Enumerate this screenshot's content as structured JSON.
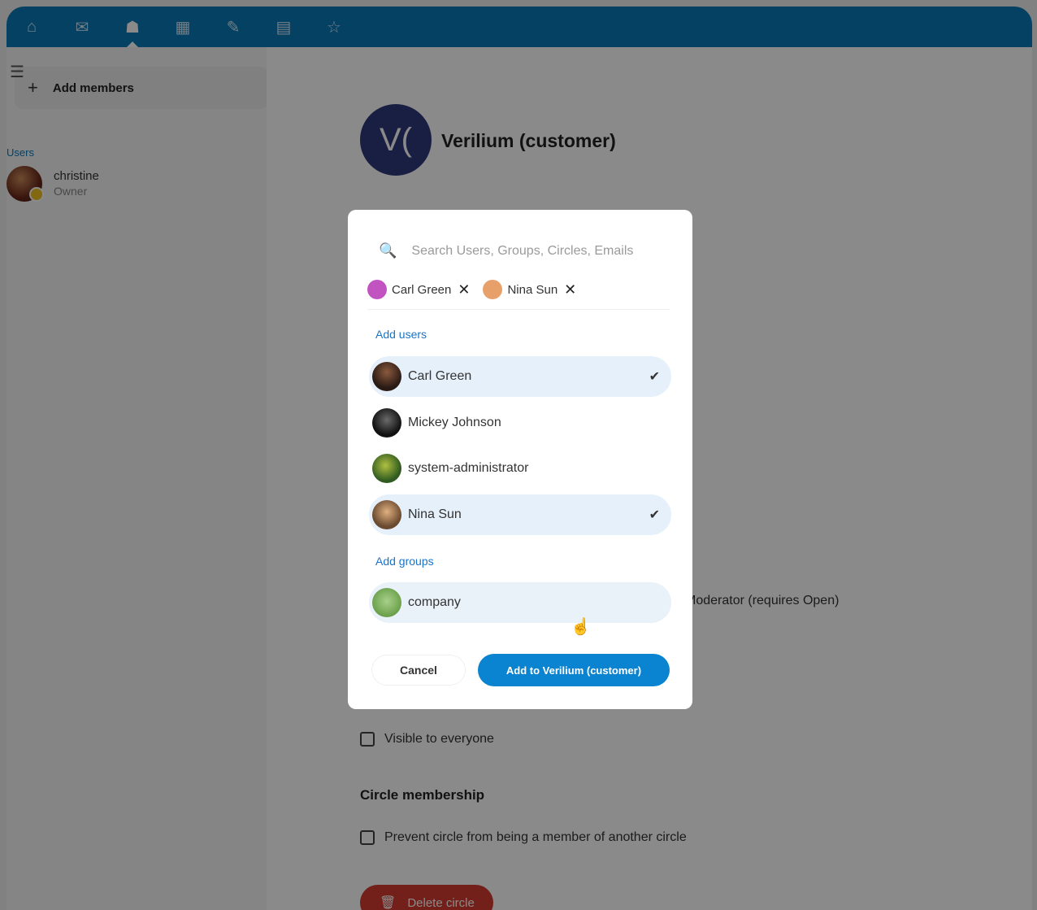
{
  "topbar": {
    "icons": [
      "home-icon",
      "mail-icon",
      "contacts-icon",
      "calendar-icon",
      "edit-icon",
      "deck-icon",
      "star-icon"
    ],
    "active_index": 2,
    "accent": "#0b78b8"
  },
  "sidebar": {
    "add_members_label": "Add members",
    "section_label": "Users",
    "member": {
      "name": "christine",
      "role": "Owner"
    }
  },
  "main": {
    "circle_avatar_initials": "V(",
    "circle_title": "Verilium (customer)",
    "background_note": "Moderator (requires Open)",
    "visible_to_everyone": "Visible to everyone",
    "membership_heading": "Circle membership",
    "prevent_membership": "Prevent circle from being a member of another circle",
    "delete_label": "Delete circle"
  },
  "modal": {
    "search_placeholder": "Search Users, Groups, Circles, Emails",
    "chips": [
      {
        "name": "Carl Green",
        "color": "#c154c1"
      },
      {
        "name": "Nina Sun",
        "color": "#e8a06a"
      }
    ],
    "add_users_label": "Add users",
    "users": [
      {
        "name": "Carl Green",
        "selected": true,
        "avatar_color": "#5b3a2e"
      },
      {
        "name": "Mickey Johnson",
        "selected": false,
        "avatar_color": "#1f1f1f"
      },
      {
        "name": "system-administrator",
        "selected": false,
        "avatar_color": "#3f6a2a"
      },
      {
        "name": "Nina Sun",
        "selected": true,
        "avatar_color": "#c58b5a"
      }
    ],
    "add_groups_label": "Add groups",
    "groups": [
      {
        "name": "company",
        "avatar_color": "#7cb36a"
      }
    ],
    "checkmark": "✔",
    "remove_glyph": "✕",
    "cancel_label": "Cancel",
    "add_label": "Add to Verilium (customer)",
    "primary_color": "#0a84d0"
  }
}
